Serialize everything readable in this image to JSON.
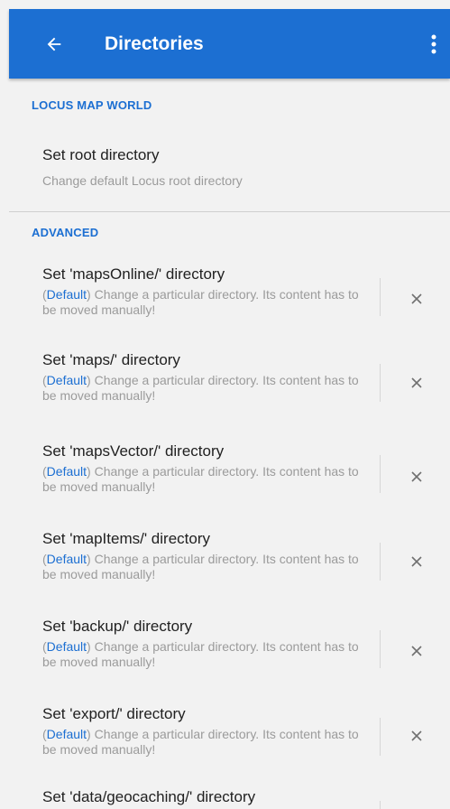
{
  "appbar": {
    "title": "Directories",
    "back_icon": "arrow-left-icon",
    "menu_icon": "more-vert-icon",
    "color": "#1c6fd2"
  },
  "sections": [
    {
      "header": "LOCUS MAP WORLD",
      "items": [
        {
          "title": "Set root directory",
          "desc": "Change default Locus root directory"
        }
      ]
    },
    {
      "header": "ADVANCED",
      "items": [
        {
          "title": "Set 'mapsOnline/' directory",
          "default_tag": "Default",
          "desc_rest": ") Change a particular directory. Its content has to be moved manually!"
        },
        {
          "title": "Set 'maps/' directory",
          "default_tag": "Default",
          "desc_rest": ") Change a particular directory. Its content has to be moved manually!"
        },
        {
          "title": "Set 'mapsVector/' directory",
          "default_tag": "Default",
          "desc_rest": ") Change a particular directory. Its content has to be moved manually!"
        },
        {
          "title": "Set 'mapItems/' directory",
          "default_tag": "Default",
          "desc_rest": ") Change a particular directory. Its content has to be moved manually!"
        },
        {
          "title": "Set 'backup/' directory",
          "default_tag": "Default",
          "desc_rest": ") Change a particular directory. Its content has to be moved manually!"
        },
        {
          "title": "Set 'export/' directory",
          "default_tag": "Default",
          "desc_rest": ") Change a particular directory. Its content has to be moved manually!"
        },
        {
          "title": "Set 'data/geocaching/' directory"
        }
      ]
    }
  ],
  "clear_icon": "close-icon",
  "open_paren": "("
}
